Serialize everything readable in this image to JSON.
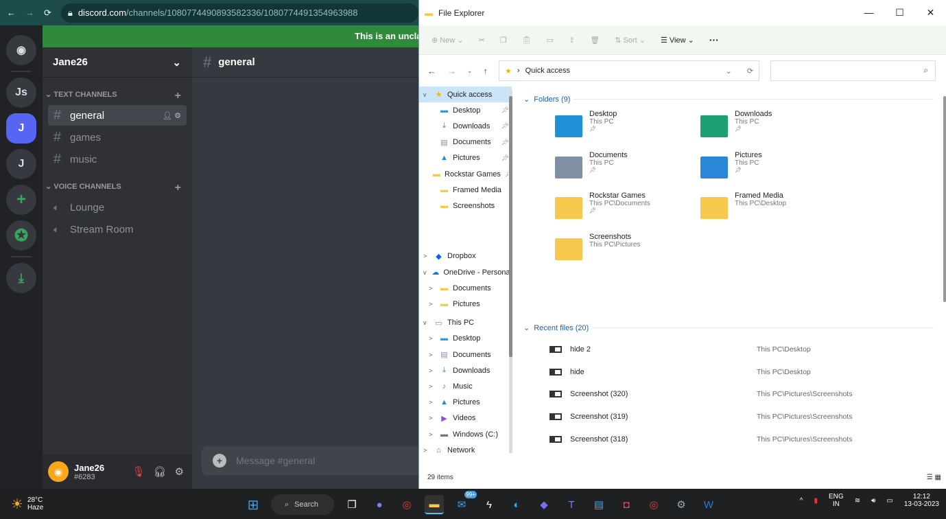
{
  "browser": {
    "url_host": "discord.com",
    "url_path": "/channels/1080774490893582336/1080774491354963988"
  },
  "discord": {
    "servers": [
      "Js",
      "J",
      "J"
    ],
    "banner": "This is an unclaimed account.",
    "guild_name": "Jane26",
    "text_category": "TEXT CHANNELS",
    "text_channels": [
      "general",
      "games",
      "music"
    ],
    "voice_category": "VOICE CHANNELS",
    "voice_channels": [
      "Lounge",
      "Stream Room"
    ],
    "current_channel": "general",
    "composer_placeholder": "Message #general",
    "user": {
      "name": "Jane26",
      "tag": "#6283"
    }
  },
  "explorer": {
    "title": "File Explorer",
    "toolbar": {
      "new": "New",
      "sort": "Sort",
      "view": "View"
    },
    "address": "Quick access",
    "nav": [
      {
        "label": "Quick access",
        "icon": "star",
        "sel": true,
        "lvl": 0,
        "exp": "v"
      },
      {
        "label": "Desktop",
        "icon": "desktop",
        "pin": true,
        "lvl": 1
      },
      {
        "label": "Downloads",
        "icon": "download",
        "pin": true,
        "lvl": 1
      },
      {
        "label": "Documents",
        "icon": "documents",
        "pin": true,
        "lvl": 1
      },
      {
        "label": "Pictures",
        "icon": "pictures",
        "pin": true,
        "lvl": 1
      },
      {
        "label": "Rockstar Games",
        "icon": "folder",
        "pin": true,
        "lvl": 1
      },
      {
        "label": "Framed Media",
        "icon": "folder",
        "lvl": 1
      },
      {
        "label": "Screenshots",
        "icon": "folder",
        "lvl": 1
      },
      {
        "label": "",
        "lvl": 1
      },
      {
        "label": "",
        "lvl": 1
      },
      {
        "label": "Dropbox",
        "icon": "dropbox",
        "lvl": 0,
        "exp": ">"
      },
      {
        "label": "OneDrive - Personal",
        "icon": "cloud",
        "lvl": 0,
        "exp": "v"
      },
      {
        "label": "Documents",
        "icon": "folder",
        "lvl": 1,
        "exp": ">"
      },
      {
        "label": "Pictures",
        "icon": "folder",
        "lvl": 1,
        "exp": ">"
      },
      {
        "label": "This PC",
        "icon": "pc",
        "lvl": 0,
        "exp": "v"
      },
      {
        "label": "Desktop",
        "icon": "desktop",
        "lvl": 1,
        "exp": ">"
      },
      {
        "label": "Documents",
        "icon": "documents",
        "lvl": 1,
        "exp": ">"
      },
      {
        "label": "Downloads",
        "icon": "download",
        "lvl": 1,
        "exp": ">"
      },
      {
        "label": "Music",
        "icon": "music",
        "lvl": 1,
        "exp": ">"
      },
      {
        "label": "Pictures",
        "icon": "pictures",
        "lvl": 1,
        "exp": ">"
      },
      {
        "label": "Videos",
        "icon": "videos",
        "lvl": 1,
        "exp": ">"
      },
      {
        "label": "Windows (C:)",
        "icon": "drive",
        "lvl": 1,
        "exp": ">"
      },
      {
        "label": "Network",
        "icon": "network",
        "lvl": 0,
        "exp": ">"
      }
    ],
    "folders_header": "Folders (9)",
    "folders": [
      {
        "name": "Desktop",
        "loc": "This PC",
        "pin": true,
        "color": "#1f8fd8"
      },
      {
        "name": "Downloads",
        "loc": "This PC",
        "pin": true,
        "color": "#1e9e73"
      },
      {
        "name": "Documents",
        "loc": "This PC",
        "pin": true,
        "color": "#7f8fa4"
      },
      {
        "name": "Pictures",
        "loc": "This PC",
        "pin": true,
        "color": "#2a86d6"
      },
      {
        "name": "Rockstar Games",
        "loc": "This PC\\Documents",
        "pin": true,
        "color": "#f6c94e"
      },
      {
        "name": "Framed Media",
        "loc": "This PC\\Desktop",
        "pin": false,
        "color": "#f6c94e"
      },
      {
        "name": "Screenshots",
        "loc": "This PC\\Pictures",
        "pin": false,
        "color": "#f6c94e"
      }
    ],
    "recent_header": "Recent files (20)",
    "recent": [
      {
        "name": "hide 2",
        "loc": "This PC\\Desktop"
      },
      {
        "name": "hide",
        "loc": "This PC\\Desktop"
      },
      {
        "name": "Screenshot (320)",
        "loc": "This PC\\Pictures\\Screenshots"
      },
      {
        "name": "Screenshot (319)",
        "loc": "This PC\\Pictures\\Screenshots"
      },
      {
        "name": "Screenshot (318)",
        "loc": "This PC\\Pictures\\Screenshots"
      }
    ],
    "status": "29 items"
  },
  "taskbar": {
    "temp": "28°C",
    "weather": "Haze",
    "search": "Search",
    "mail_badge": "99+",
    "lang1": "ENG",
    "lang2": "IN",
    "time": "12:12",
    "date": "13-03-2023"
  }
}
